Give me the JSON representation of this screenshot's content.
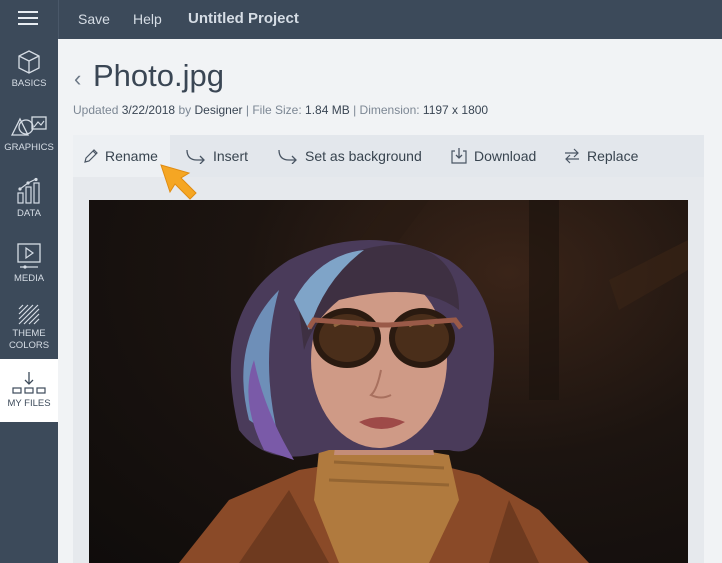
{
  "topbar": {
    "save_label": "Save",
    "help_label": "Help",
    "project_title": "Untitled Project"
  },
  "sidebar": {
    "items": [
      {
        "label": "BASICS",
        "icon": "cube-icon"
      },
      {
        "label": "GRAPHICS",
        "icon": "shapes-icon"
      },
      {
        "label": "DATA",
        "icon": "chart-icon"
      },
      {
        "label": "MEDIA",
        "icon": "play-icon"
      },
      {
        "label_line1": "THEME",
        "label_line2": "COLORS",
        "icon": "pattern-icon"
      },
      {
        "label": "MY FILES",
        "icon": "download-files-icon",
        "active": true
      }
    ]
  },
  "file": {
    "title": "Photo.jpg",
    "updated_label": "Updated",
    "updated_date": "3/22/2018",
    "by_label": "by",
    "author": "Designer",
    "size_label": "File Size:",
    "size_value": "1.84 MB",
    "dimension_label": "Dimension:",
    "dimension_value": "1197 x 1800"
  },
  "toolbar": {
    "rename_label": "Rename",
    "insert_label": "Insert",
    "background_label": "Set as background",
    "download_label": "Download",
    "replace_label": "Replace"
  },
  "colors": {
    "sidebar_bg": "#3c4a5a",
    "cursor_accent": "#f5a623"
  }
}
